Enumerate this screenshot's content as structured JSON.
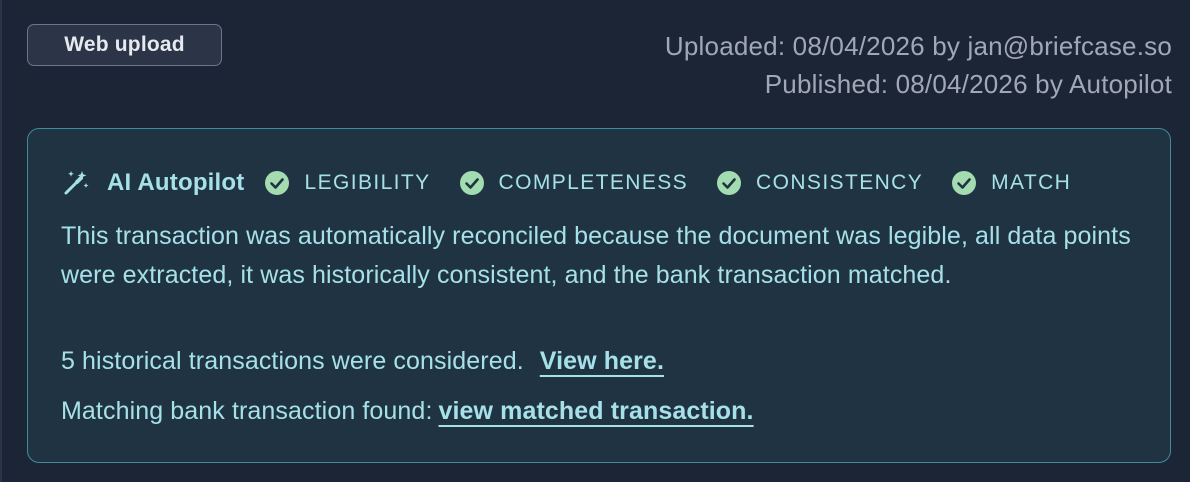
{
  "source_tag": "Web upload",
  "meta": {
    "uploaded": "Uploaded: 08/04/2026 by jan@briefcase.so",
    "published": "Published: 08/04/2026 by Autopilot"
  },
  "autopilot": {
    "title": "AI Autopilot",
    "icon": "magic-wand-icon",
    "checks": [
      {
        "label": "LEGIBILITY",
        "icon": "check-circle-icon"
      },
      {
        "label": "COMPLETENESS",
        "icon": "check-circle-icon"
      },
      {
        "label": "CONSISTENCY",
        "icon": "check-circle-icon"
      },
      {
        "label": "MATCH",
        "icon": "check-circle-icon"
      }
    ],
    "description": "This transaction was automatically reconciled because the document was legible, all data points were extracted, it was historically consistent, and the bank transaction matched.",
    "historical_text": "5 historical transactions were considered.",
    "historical_link": "View here.",
    "bank_text": "Matching bank transaction found:",
    "bank_link": "view matched transaction."
  },
  "colors": {
    "background": "#1c2536",
    "card_background": "#1f3342",
    "card_border": "#3f8c9a",
    "accent_text": "#a6e1ea",
    "check_fill": "#a3dcb0",
    "check_mark": "#1f3342",
    "meta_text": "#a1a8b5"
  }
}
